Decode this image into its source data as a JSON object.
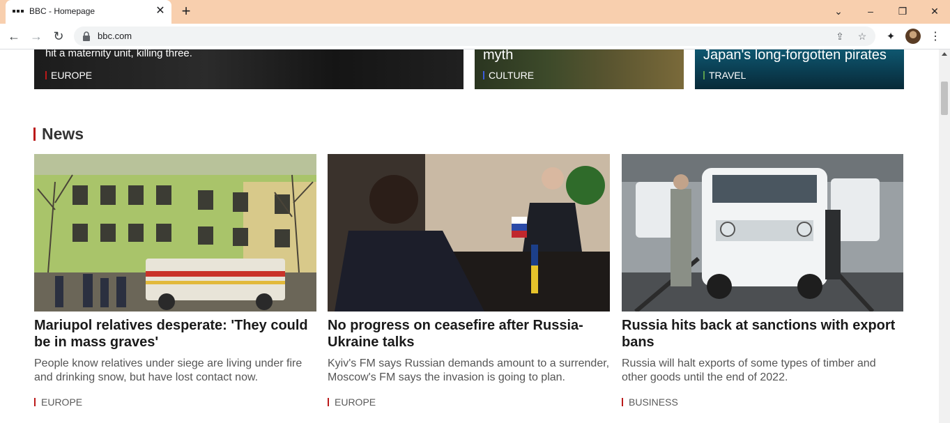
{
  "browser": {
    "tab_title": "BBC - Homepage",
    "tab_close": "✕",
    "new_tab": "+",
    "url": "bbc.com",
    "back": "←",
    "forward": "→",
    "reload": "↻",
    "share": "⇪",
    "bookmark": "☆",
    "extensions": "✦",
    "menu": "⋮",
    "tab_search": "⌄",
    "minimize": "–",
    "restore": "❐",
    "close": "✕",
    "chrome_color": "#f8cfae"
  },
  "top_row": [
    {
      "text": "hit a maternity unit, killing three.",
      "tag": "EUROPE",
      "tag_color": "#bb1919"
    },
    {
      "text": "myth",
      "tag": "CULTURE",
      "tag_color": "#3b5bdb"
    },
    {
      "text": "Japan's long-forgotten pirates",
      "tag": "TRAVEL",
      "tag_color": "#5a9e4d"
    }
  ],
  "section": {
    "title": "News",
    "accent": "#bb1919"
  },
  "stories": [
    {
      "title": "Mariupol relatives desperate: 'They could be in mass graves'",
      "summary": "People know relatives under siege are living under fire and drinking snow, but have lost contact now.",
      "tag": "EUROPE"
    },
    {
      "title": "No progress on ceasefire after Russia-Ukraine talks",
      "summary": "Kyiv's FM says Russian demands amount to a surrender, Moscow's FM says the invasion is going to plan.",
      "tag": "EUROPE"
    },
    {
      "title": "Russia hits back at sanctions with export bans",
      "summary": "Russia will halt exports of some types of timber and other goods until the end of 2022.",
      "tag": "BUSINESS"
    }
  ]
}
